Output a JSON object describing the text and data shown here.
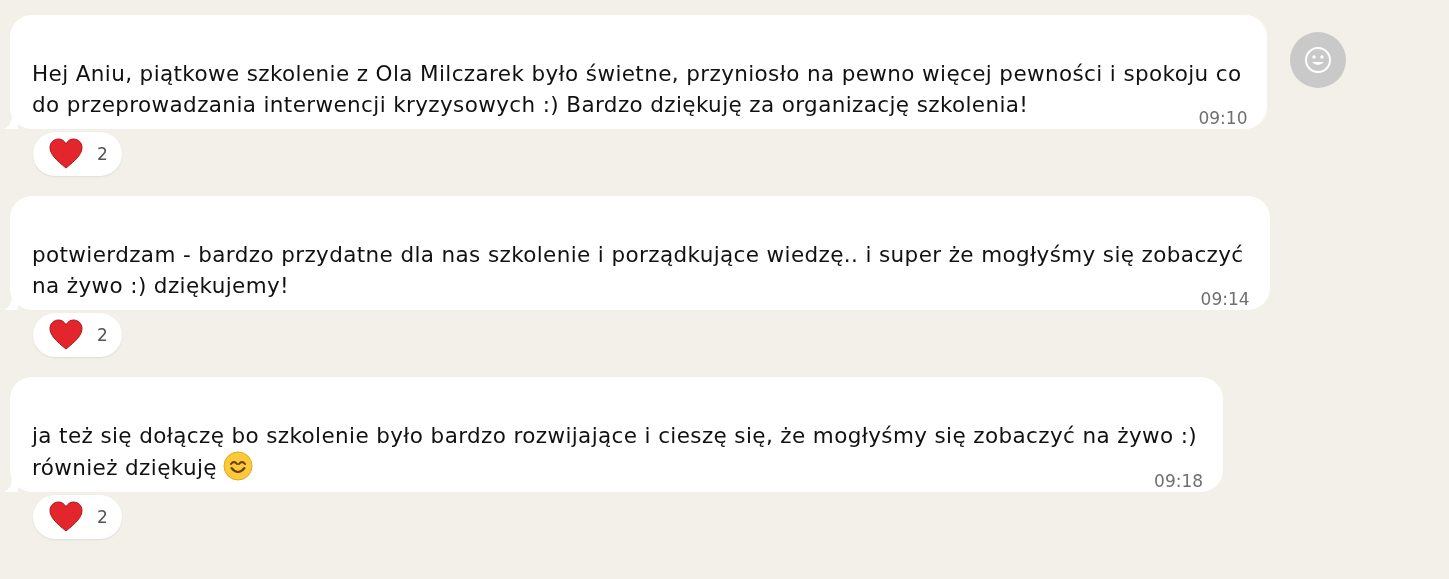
{
  "messages": [
    {
      "kind": "plain",
      "lines": [
        "Hej Aniu, piątkowe szkolenie z Ola Milczarek było świetne, przyniosło na pewno więcej pewności i spokoju co",
        "do przeprowadzania interwencji kryzysowych :) Bardzo dziękuję za organizację szkolenia!"
      ],
      "time": "09:10",
      "reaction": {
        "kind": "heart",
        "count": "2"
      }
    },
    {
      "kind": "plain",
      "lines": [
        "potwierdzam - bardzo przydatne dla nas szkolenie i porządkujące wiedzę.. i super że mogłyśmy się zobaczyć",
        "na żywo :) dziękujemy!"
      ],
      "time": "09:14",
      "reaction": {
        "kind": "heart",
        "count": "2"
      }
    },
    {
      "kind": "smile_emoji",
      "lines": [
        "ja też się dołączę bo szkolenie było bardzo rozwijające i cieszę się, że mogłyśmy się zobaczyć na żywo :)",
        "również dziękuję"
      ],
      "time": "09:18",
      "reaction": {
        "kind": "heart",
        "count": "2"
      }
    }
  ]
}
